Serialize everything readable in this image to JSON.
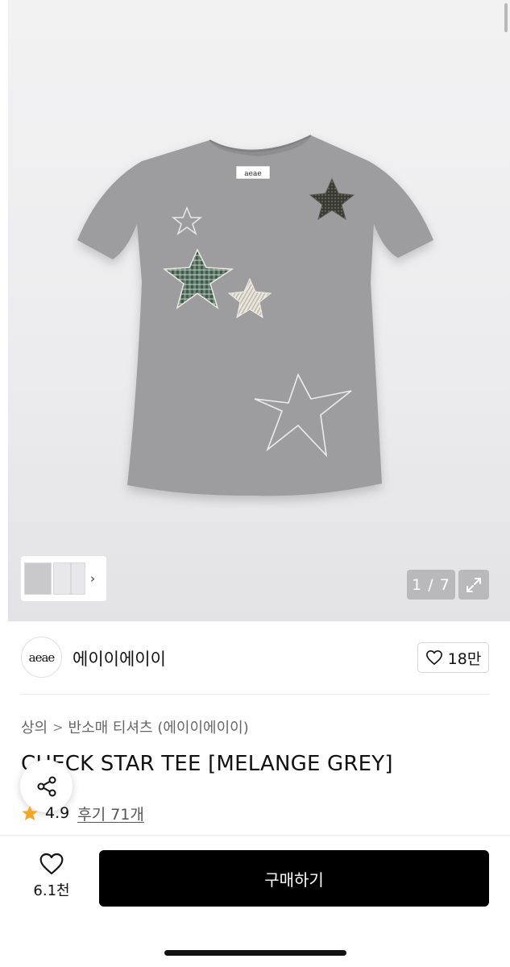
{
  "gallery": {
    "counter_text": "1 / 7",
    "thumbnail_arrow": "›",
    "tee_label_text": "aeae",
    "expand_icon": "expand-icon"
  },
  "brand": {
    "logo_text": "aeae",
    "name": "에이이에이이",
    "like_count": "18만"
  },
  "breadcrumb": {
    "items": [
      "상의",
      "반소매 티셔츠 (에이이에이이)"
    ],
    "separator": ">"
  },
  "product": {
    "title": "CHECK STAR TEE [MELANGE GREY]",
    "rating": "4.9",
    "reviews_label": "후기 71개",
    "star_color": "#F5A623"
  },
  "bottom_bar": {
    "wish_count": "6.1천",
    "buy_label": "구매하기",
    "buy_color": "#000000"
  }
}
